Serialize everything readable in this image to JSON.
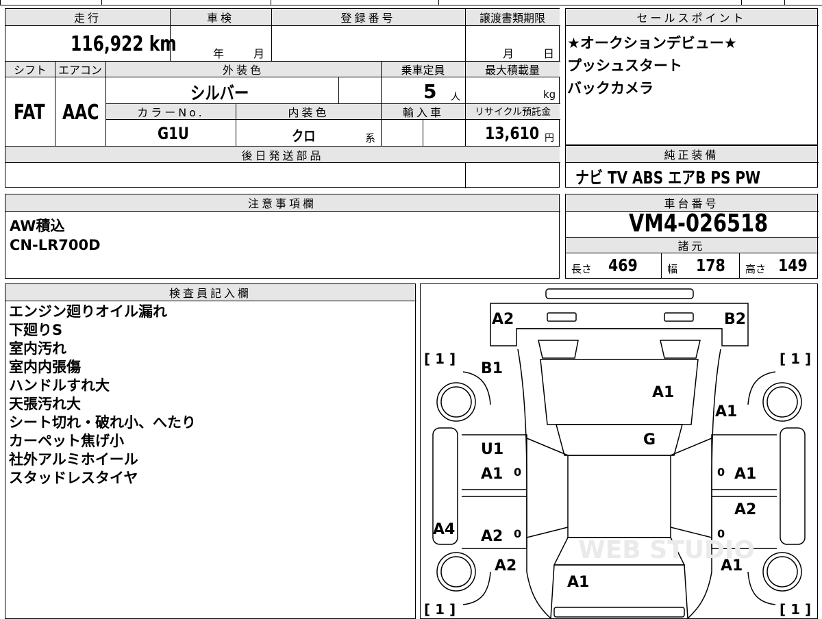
{
  "vehicle": {
    "mileage_label": "走行",
    "mileage": "116,922",
    "mileage_unit": "km",
    "inspection_label": "車検",
    "inspection_year": "年",
    "inspection_month": "月",
    "registration_label": "登録番号",
    "transfer_label": "譲渡書類期限",
    "transfer_month": "月",
    "transfer_day": "日",
    "shift_label": "シフト",
    "shift": "FAT",
    "ac_label": "エアコン",
    "ac": "AAC",
    "exterior_label": "外装色",
    "exterior_color": "シルバー",
    "capacity_label": "乗車定員",
    "capacity": "5",
    "capacity_unit": "人",
    "maxload_label": "最大積載量",
    "maxload_unit": "kg",
    "color_no_label": "カラーNo.",
    "color_no": "G1U",
    "interior_label": "内装色",
    "interior_color": "クロ",
    "interior_suffix": "系",
    "import_label": "輸入車",
    "recycle_label": "リサイクル預託金",
    "recycle_fee": "13,610",
    "recycle_unit": "円",
    "later_parts_label": "後日発送部品"
  },
  "sales_points": {
    "title": "セールスポイント",
    "lines": [
      "★オークションデビュー★",
      "プッシュスタート",
      "バックカメラ"
    ]
  },
  "equipment": {
    "title": "純正装備",
    "items": "ナビ TV ABS エアB PS PW"
  },
  "caution": {
    "title": "注意事項欄",
    "lines": [
      "AW積込",
      "CN-LR700D"
    ]
  },
  "chassis": {
    "title": "車台番号",
    "number": "VM4-026518",
    "specs_title": "諸元",
    "length_label": "長さ",
    "length": "469",
    "width_label": "幅",
    "width": "178",
    "height_label": "高さ",
    "height": "149"
  },
  "inspector": {
    "title": "検査員記入欄",
    "lines": [
      "エンジン廻りオイル漏れ",
      "下廻りS",
      "室内汚れ",
      "室内内張傷",
      "ハンドルすれ大",
      "天張汚れ大",
      "シート切れ・破れ小、へたり",
      "カーペット焦げ小",
      "社外アルミホイール",
      "スタッドレスタイヤ"
    ]
  },
  "diagram": {
    "marks": [
      "A2",
      "B2",
      "B1",
      "A1",
      "A1",
      "G",
      "U1",
      "A1",
      "A1",
      "A2",
      "A4",
      "A2",
      "A2",
      "A1",
      "A1"
    ],
    "tire_marks": [
      "[ 1 ]",
      "[ 1 ]",
      "[ 1 ]",
      "[ 1 ]"
    ],
    "small": [
      "0",
      "0",
      "0",
      "0"
    ],
    "watermark": "WEB STUDIO"
  }
}
